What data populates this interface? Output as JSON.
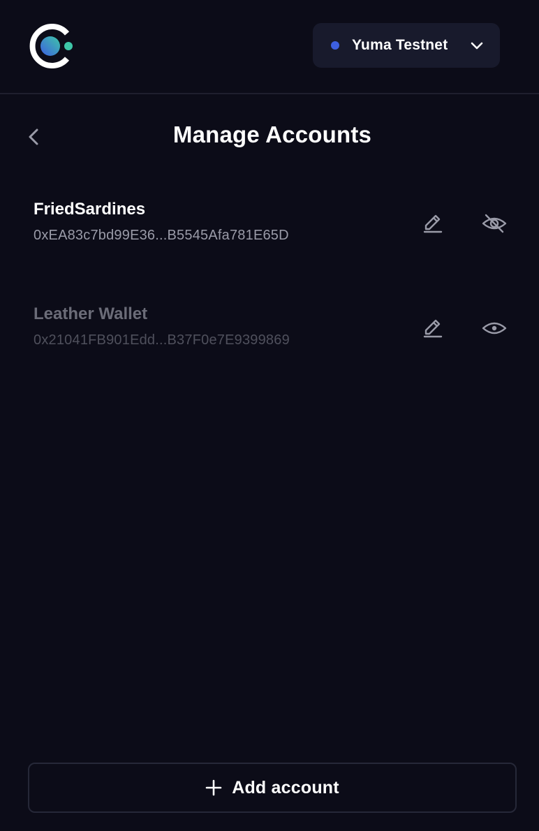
{
  "header": {
    "network": {
      "label": "Yuma Testnet",
      "dot_color": "#3d5fe0"
    },
    "logo_icon": "app-logo-icon"
  },
  "page": {
    "title": "Manage Accounts",
    "back_icon": "chevron-left-icon"
  },
  "accounts": [
    {
      "name": "FriedSardines",
      "address": "0xEA83c7bd99E36...B5545Afa781E65D",
      "hidden": false,
      "visibility_icon": "eye-off-icon"
    },
    {
      "name": "Leather Wallet",
      "address": "0x21041FB901Edd...B37F0e7E9399869",
      "hidden": true,
      "visibility_icon": "eye-icon"
    }
  ],
  "footer": {
    "add_label": "Add account",
    "add_icon": "plus-icon"
  },
  "colors": {
    "background": "#0c0c18",
    "surface": "#181a2c",
    "accent_teal": "#3ec6a8",
    "accent_blue": "#3d5fe0"
  }
}
